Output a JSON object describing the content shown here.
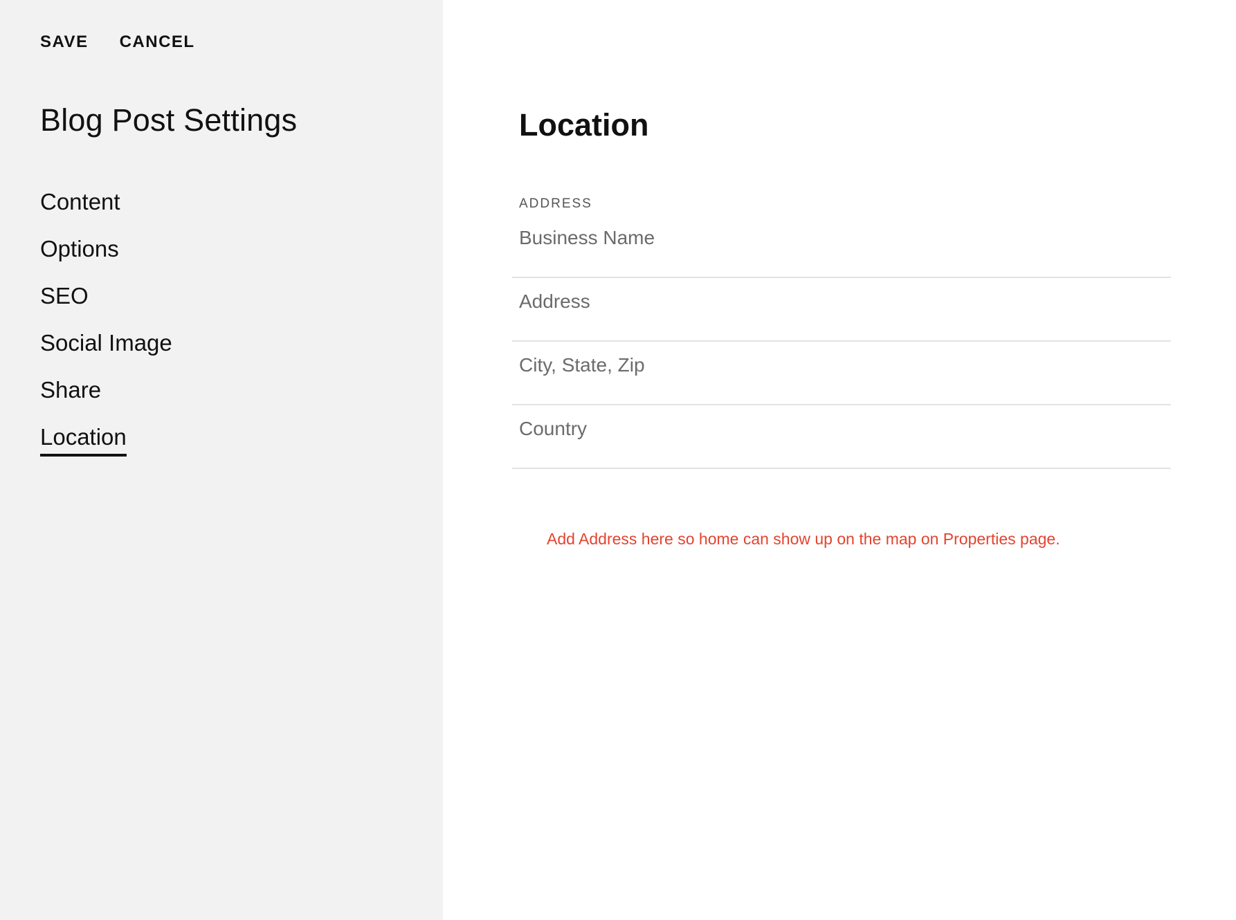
{
  "toolbar": {
    "save_label": "SAVE",
    "cancel_label": "CANCEL"
  },
  "sidebar": {
    "title": "Blog Post Settings",
    "items": [
      {
        "label": "Content",
        "active": false
      },
      {
        "label": "Options",
        "active": false
      },
      {
        "label": "SEO",
        "active": false
      },
      {
        "label": "Social Image",
        "active": false
      },
      {
        "label": "Share",
        "active": false
      },
      {
        "label": "Location",
        "active": true
      }
    ]
  },
  "main": {
    "title": "Location",
    "section_label": "ADDRESS",
    "fields": [
      {
        "placeholder": "Business Name",
        "value": ""
      },
      {
        "placeholder": "Address",
        "value": ""
      },
      {
        "placeholder": "City, State, Zip",
        "value": ""
      },
      {
        "placeholder": "Country",
        "value": ""
      }
    ],
    "note": "Add Address here so home can show up on the map on Properties page."
  },
  "colors": {
    "sidebar_bg": "#f2f2f2",
    "note_color": "#e4432f"
  }
}
